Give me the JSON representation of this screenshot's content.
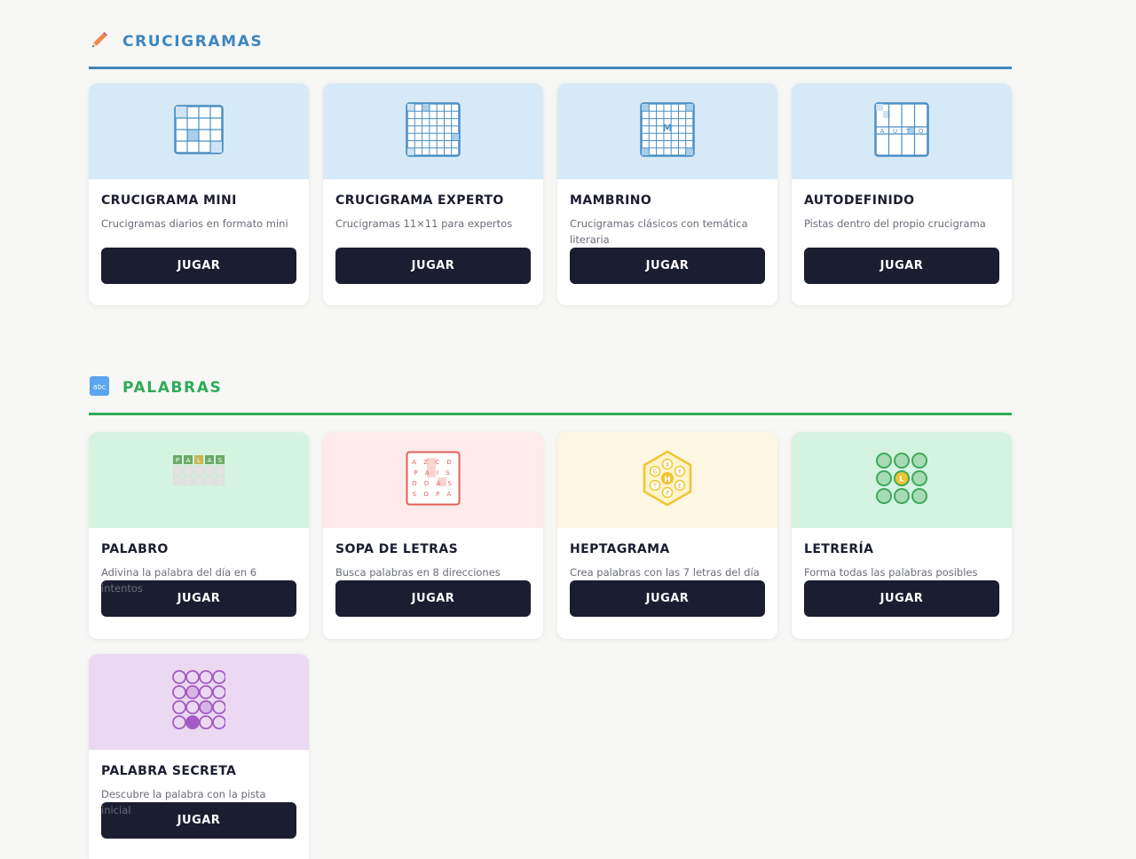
{
  "sections": [
    {
      "title": "CRUCIGRAMAS",
      "icon": "pencil-icon",
      "color": "#3c86c1",
      "cards": [
        {
          "title": "CRUCIGRAMA MINI",
          "desc": "Crucigramas diarios en formato mini",
          "button": "JUGAR",
          "icon": "mini-grid-icon",
          "bg": "#d6e9f7"
        },
        {
          "title": "CRUCIGRAMA EXPERTO",
          "desc": "Crucigramas 11×11 para expertos",
          "button": "JUGAR",
          "icon": "expert-grid-icon",
          "bg": "#d6e9f7"
        },
        {
          "title": "MAMBRINO",
          "desc": "Crucigramas clásicos con temática literaria",
          "button": "JUGAR",
          "icon": "mambrino-grid-icon",
          "bg": "#d6e9f7",
          "icon_letter": "M"
        },
        {
          "title": "AUTODEFINIDO",
          "desc": "Pistas dentro del propio crucigrama",
          "button": "JUGAR",
          "icon": "autodefinido-grid-icon",
          "bg": "#d6e9f7",
          "icon_letters": [
            "A",
            "U",
            "T",
            "O"
          ]
        }
      ]
    },
    {
      "title": "PALABRAS",
      "icon": "abc-icon",
      "icon_label": "abc",
      "color": "#2faa58",
      "cards": [
        {
          "title": "PALABRO",
          "desc": "Adivina la palabra del día en 6 intentos",
          "button": "JUGAR",
          "icon": "palabro-tiles-icon",
          "bg": "#d4f3e0",
          "icon_letters": [
            "P",
            "A",
            "L",
            "A",
            "S"
          ]
        },
        {
          "title": "SOPA DE LETRAS",
          "desc": "Busca palabras en 8 direcciones",
          "button": "JUGAR",
          "icon": "word-search-icon",
          "bg": "#fdeaea",
          "icon_rows": [
            "A Z C D",
            "P A I S",
            "O D A S",
            "S O P A"
          ]
        },
        {
          "title": "HEPTAGRAMA",
          "desc": "Crea palabras con las 7 letras del día",
          "button": "JUGAR",
          "icon": "hexagon-letters-icon",
          "bg": "#fdf6e2",
          "icon_center": "H",
          "icon_letters": [
            "A",
            "E",
            "E",
            "P",
            "T",
            "G"
          ]
        },
        {
          "title": "LETRERÍA",
          "desc": "Forma todas las palabras posibles",
          "button": "JUGAR",
          "icon": "circle-grid-icon",
          "bg": "#d4f3e0",
          "icon_center": "L"
        },
        {
          "title": "PALABRA SECRETA",
          "desc": "Descubre la palabra con la pista inicial",
          "button": "JUGAR",
          "icon": "secret-circles-icon",
          "bg": "#ead9f0"
        }
      ]
    }
  ]
}
